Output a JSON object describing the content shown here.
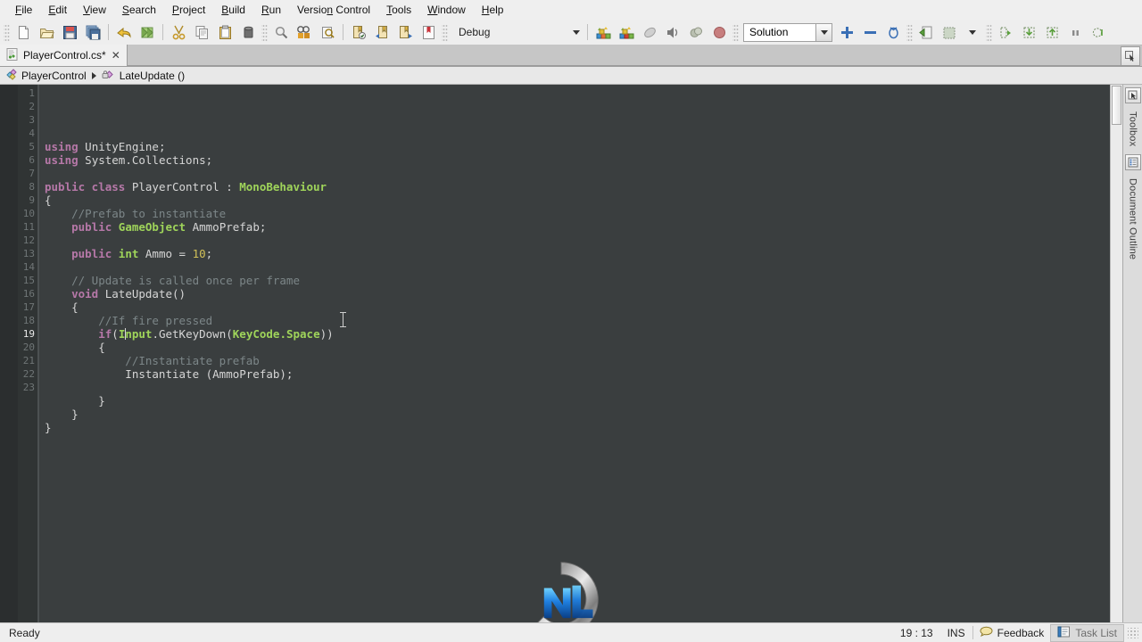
{
  "menubar": {
    "items": [
      {
        "label": "File",
        "accel": "F"
      },
      {
        "label": "Edit",
        "accel": "E"
      },
      {
        "label": "View",
        "accel": "V"
      },
      {
        "label": "Search",
        "accel": "S"
      },
      {
        "label": "Project",
        "accel": "P"
      },
      {
        "label": "Build",
        "accel": "B"
      },
      {
        "label": "Run",
        "accel": "R"
      },
      {
        "label": "Version Control",
        "accel": "n"
      },
      {
        "label": "Tools",
        "accel": "T"
      },
      {
        "label": "Window",
        "accel": "W"
      },
      {
        "label": "Help",
        "accel": "H"
      }
    ]
  },
  "toolbar": {
    "groups": [
      {
        "icons": [
          "new-file-icon",
          "open-folder-icon",
          "save-icon",
          "save-all-icon"
        ]
      },
      {
        "icons": [
          "undo-icon",
          "redo-icon"
        ]
      },
      {
        "icons": [
          "cut-icon",
          "copy-icon",
          "paste-icon",
          "delete-icon"
        ]
      },
      {
        "icons": [
          "find-icon",
          "find-replace-icon",
          "find-in-files-icon"
        ]
      },
      {
        "icons": [
          "bookmark-toggle-icon",
          "bookmark-prev-icon",
          "bookmark-next-icon",
          "bookmark-clear-icon"
        ]
      }
    ],
    "configuration": {
      "value": "Debug",
      "name": "configuration-combo"
    },
    "run_icons": [
      "build-icon",
      "rebuild-icon",
      "stop-build-icon",
      "run-icon",
      "debug-icon",
      "stop-icon"
    ],
    "scope": {
      "value": "Solution",
      "name": "scope-combo"
    },
    "zoom_icons": [
      "zoom-in-icon",
      "zoom-out-icon",
      "zoom-reset-icon"
    ],
    "vcs_icons": [
      "vcs-update-icon",
      "vcs-commit-icon"
    ],
    "debug_icons": [
      "step-over-icon",
      "step-into-icon",
      "step-out-icon",
      "pause-icon",
      "continue-icon"
    ]
  },
  "tabs": {
    "active": {
      "label": "PlayerControl.cs*",
      "icon": "csharp-file-icon",
      "close": "✕"
    },
    "overflow_icon": "tab-list-icon"
  },
  "breadcrumb": {
    "class": {
      "label": "PlayerControl",
      "icon": "class-icon"
    },
    "member": {
      "label": "LateUpdate ()",
      "icon": "method-icon"
    }
  },
  "editor": {
    "current_line": 19,
    "line_count": 23,
    "line_numbers": [
      1,
      2,
      3,
      4,
      5,
      6,
      7,
      8,
      9,
      10,
      11,
      12,
      13,
      14,
      15,
      16,
      17,
      18,
      19,
      20,
      21,
      22,
      23
    ],
    "lines": [
      [
        {
          "t": "using",
          "c": "kw"
        },
        {
          "t": " UnityEngine;",
          "c": "pln"
        }
      ],
      [
        {
          "t": "using",
          "c": "kw"
        },
        {
          "t": " System.Collections;",
          "c": "pln"
        }
      ],
      [],
      [
        {
          "t": "public class",
          "c": "kw"
        },
        {
          "t": " PlayerControl : ",
          "c": "pln"
        },
        {
          "t": "MonoBehaviour",
          "c": "typ"
        }
      ],
      [
        {
          "t": "{",
          "c": "pln"
        }
      ],
      [
        {
          "t": "    //Prefab to instantiate",
          "c": "cmt"
        }
      ],
      [
        {
          "t": "    ",
          "c": "pln"
        },
        {
          "t": "public",
          "c": "kw"
        },
        {
          "t": " ",
          "c": "pln"
        },
        {
          "t": "GameObject",
          "c": "typ"
        },
        {
          "t": " AmmoPrefab;",
          "c": "pln"
        }
      ],
      [],
      [
        {
          "t": "    ",
          "c": "pln"
        },
        {
          "t": "public",
          "c": "kw"
        },
        {
          "t": " ",
          "c": "pln"
        },
        {
          "t": "int",
          "c": "typ"
        },
        {
          "t": " Ammo = ",
          "c": "pln"
        },
        {
          "t": "10",
          "c": "num"
        },
        {
          "t": ";",
          "c": "pln"
        }
      ],
      [],
      [
        {
          "t": "    // Update is called once per frame",
          "c": "cmt"
        }
      ],
      [
        {
          "t": "    ",
          "c": "pln"
        },
        {
          "t": "void",
          "c": "kw"
        },
        {
          "t": " LateUpdate()",
          "c": "pln"
        }
      ],
      [
        {
          "t": "    {",
          "c": "pln"
        }
      ],
      [
        {
          "t": "        //If fire pressed",
          "c": "cmt"
        }
      ],
      [
        {
          "t": "        ",
          "c": "pln"
        },
        {
          "t": "if",
          "c": "kw"
        },
        {
          "t": "(",
          "c": "pln"
        },
        {
          "t": "Input",
          "c": "typ"
        },
        {
          "t": ".GetKeyDown(",
          "c": "pln"
        },
        {
          "t": "KeyCode.Space",
          "c": "typ"
        },
        {
          "t": "))",
          "c": "pln"
        }
      ],
      [
        {
          "t": "        {",
          "c": "pln"
        }
      ],
      [
        {
          "t": "            //Instantiate prefab",
          "c": "cmt"
        }
      ],
      [
        {
          "t": "            Instantiate (AmmoPrefab);",
          "c": "pln"
        }
      ],
      [],
      [
        {
          "t": "        }",
          "c": "pln"
        }
      ],
      [
        {
          "t": "    }",
          "c": "pln"
        }
      ],
      [
        {
          "t": "}",
          "c": "pln"
        }
      ],
      []
    ]
  },
  "rightdock": {
    "tabs": [
      {
        "label": "Toolbox",
        "icon": "toolbox-icon"
      },
      {
        "label": "Document Outline",
        "icon": "document-outline-icon"
      }
    ]
  },
  "statusbar": {
    "message": "Ready",
    "caret": "19 : 13",
    "insert_mode": "INS",
    "feedback": {
      "label": "Feedback",
      "icon": "feedback-balloon-icon"
    },
    "task_list": {
      "label": "Task List",
      "icon": "task-list-icon"
    }
  },
  "watermark": {
    "name": "nl-logo-watermark"
  }
}
